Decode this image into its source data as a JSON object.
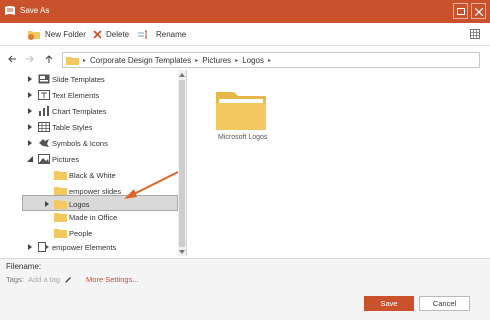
{
  "window": {
    "title": "Save As"
  },
  "toolbar": {
    "new_folder_label": "New Folder",
    "delete_label": "Delete",
    "rename_label": "Rename"
  },
  "address": {
    "crumbs": [
      "Corporate Design Templates",
      "Pictures",
      "Logos"
    ]
  },
  "tree": {
    "items": [
      {
        "label": "Slide Templates",
        "icon": "slide-templates-icon"
      },
      {
        "label": "Text Elements",
        "icon": "text-elements-icon"
      },
      {
        "label": "Chart Templates",
        "icon": "chart-icon"
      },
      {
        "label": "Table Styles",
        "icon": "table-icon"
      },
      {
        "label": "Symbols & Icons",
        "icon": "symbols-icon"
      },
      {
        "label": "Pictures",
        "icon": "pictures-icon"
      },
      {
        "label": "Black & White",
        "icon": "folder-icon"
      },
      {
        "label": "empower slides",
        "icon": "folder-icon"
      },
      {
        "label": "Logos",
        "icon": "folder-icon"
      },
      {
        "label": "Made in Office",
        "icon": "folder-icon"
      },
      {
        "label": "People",
        "icon": "folder-icon"
      },
      {
        "label": "empower Elements",
        "icon": "empower-elements-icon"
      }
    ],
    "selected": "Logos"
  },
  "content": {
    "folders": [
      {
        "label": "Microsoft Logos"
      }
    ]
  },
  "bottom": {
    "filename_label": "Filename:",
    "tags_label": "Tags:",
    "tags_placeholder": "Add a tag",
    "more_settings_label": "More Settings...",
    "save_label": "Save",
    "cancel_label": "Cancel"
  },
  "colors": {
    "accent": "#c9522c",
    "folder": "#f3c85f",
    "selection": "#d9d9d9"
  }
}
